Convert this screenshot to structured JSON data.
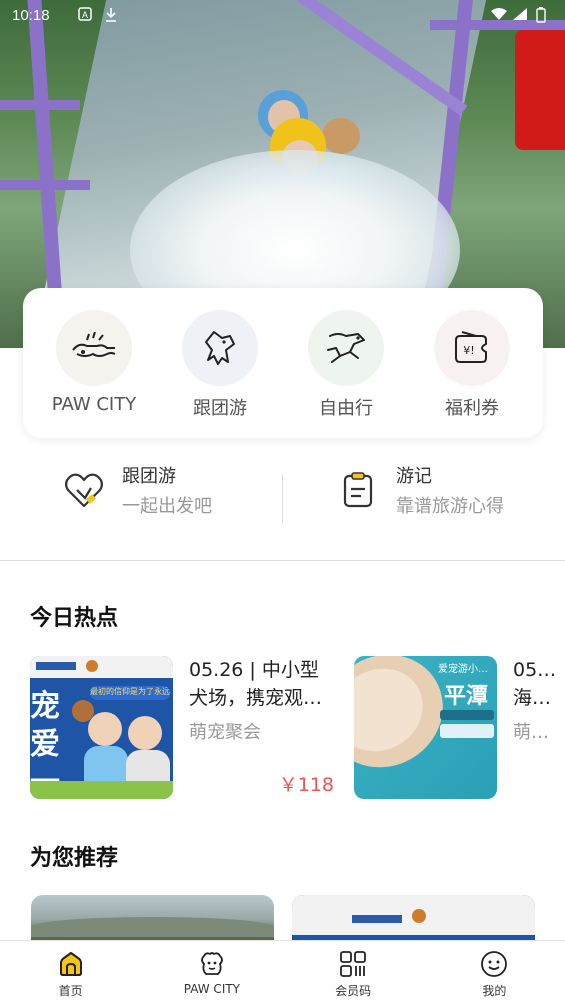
{
  "status_bar": {
    "time": "10:18"
  },
  "categories": [
    {
      "label": "PAW CITY",
      "icon": "handshake-paw-icon",
      "bg": "#f5f3ee"
    },
    {
      "label": "跟团游",
      "icon": "dog-group-icon",
      "bg": "#eef2f6"
    },
    {
      "label": "自由行",
      "icon": "running-dog-icon",
      "bg": "#eef5ee"
    },
    {
      "label": "福利券",
      "icon": "coupon-icon",
      "bg": "#f8f1f1"
    }
  ],
  "quick_links": [
    {
      "title": "跟团游",
      "subtitle": "一起出发吧",
      "icon": "heart-tag-icon"
    },
    {
      "title": "游记",
      "subtitle": "靠谱旅游心得",
      "icon": "notepad-icon"
    }
  ],
  "hot": {
    "title": "今日热点",
    "items": [
      {
        "title": "05.26 | 中小型犬场，携宠观…",
        "tag": "萌宠聚会",
        "price": "￥118",
        "thumb_text": "宠爱一申",
        "thumb_subtext": "最初的信仰是为了永远的"
      },
      {
        "title": "05… 海…",
        "tag": "萌…",
        "price": "",
        "thumb_text": "平潭",
        "thumb_subtext": "爱宠游小…"
      }
    ]
  },
  "recommend": {
    "title": "为您推荐"
  },
  "bottom_nav": [
    {
      "label": "首页",
      "icon": "home-icon",
      "active": true
    },
    {
      "label": "PAW CITY",
      "icon": "pet-face-icon",
      "active": false
    },
    {
      "label": "会员码",
      "icon": "member-code-icon",
      "active": false
    },
    {
      "label": "我的",
      "icon": "smiley-icon",
      "active": false
    }
  ],
  "colors": {
    "accent": "#f5c518",
    "price": "#ee5555"
  }
}
